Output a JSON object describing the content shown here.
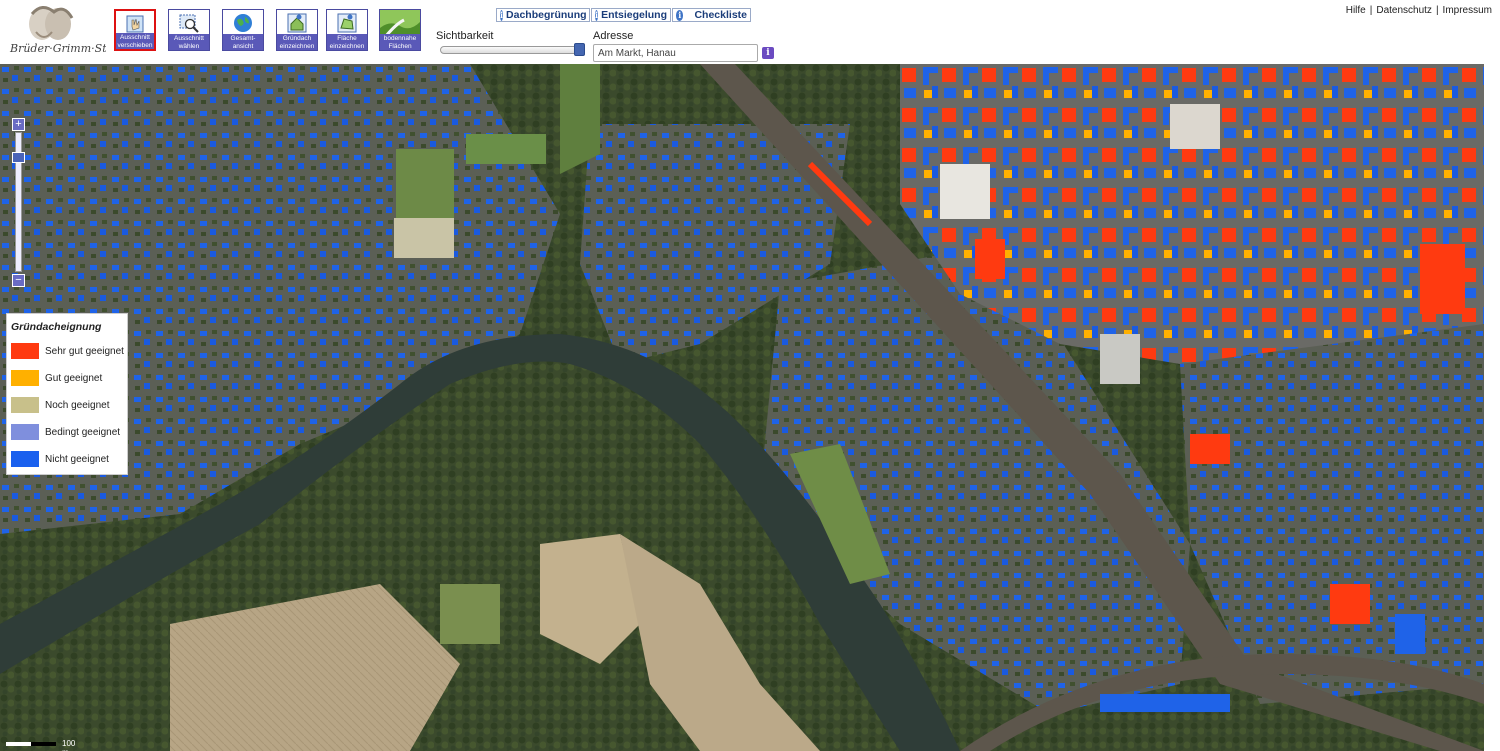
{
  "toolbar": {
    "buttons": [
      {
        "label": "Ausschnitt verschieben",
        "icon": "pan-icon"
      },
      {
        "label": "Ausschnitt wählen",
        "icon": "zoom-select-icon"
      },
      {
        "label": "Gesamt-ansicht",
        "icon": "globe-icon"
      },
      {
        "label": "Gründach einzeichnen",
        "icon": "roof-draw-icon"
      },
      {
        "label": "Fläche einzeichnen",
        "icon": "area-draw-icon"
      },
      {
        "label": "bodennahe Flächen",
        "icon": "landscape-icon"
      }
    ]
  },
  "links": {
    "dach": "Dachbegrünung",
    "ents": "Entsiegelung",
    "check": "Checkliste"
  },
  "sichtbarkeit": {
    "label": "Sichtbarkeit",
    "value": 0.95
  },
  "adresse": {
    "label": "Adresse",
    "value": "Am Markt, Hanau"
  },
  "top_links": {
    "hilfe": "Hilfe",
    "datenschutz": "Datenschutz",
    "impressum": "Impressum"
  },
  "legend": {
    "title": "Gründacheignung",
    "items": [
      {
        "label": "Sehr gut geeignet",
        "color": "#ff3a10"
      },
      {
        "label": "Gut geeignet",
        "color": "#ffb000"
      },
      {
        "label": "Noch geeignet",
        "color": "#c8c08a"
      },
      {
        "label": "Bedingt geeignet",
        "color": "#7f8fdd"
      },
      {
        "label": "Nicht geeignet",
        "color": "#1a60ee"
      }
    ]
  },
  "zoom": {
    "plus": "+",
    "minus": "−"
  },
  "scale": "100 m"
}
